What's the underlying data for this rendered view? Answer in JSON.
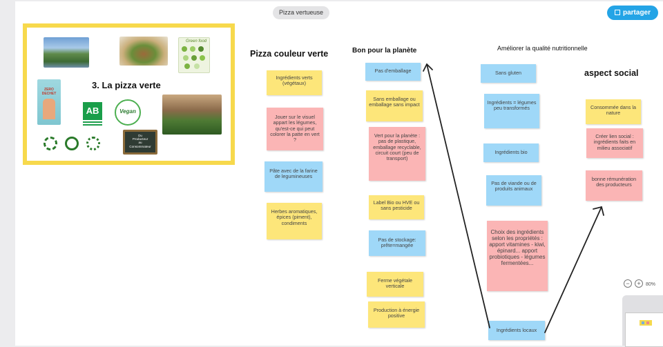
{
  "header": {
    "board_title": "Pizza vertueuse",
    "share_label": "partager",
    "share_icon": "qr-icon"
  },
  "slide": {
    "title": "3. La pizza verte",
    "images": [
      "waterfall-photo",
      "burger-photo",
      "green-food-poster",
      "zero-dechet-book",
      "ab-bio-logo",
      "vegan-logo",
      "garden-people-photo",
      "recycle-logos",
      "producteur-consommateur-chalkboard"
    ],
    "green_food_label": "Green food",
    "book_title": "ZERO DECHET",
    "ab_label": "AB",
    "vegan_label": "Vegan",
    "chalk_lines": [
      "Du",
      "Producteur",
      "au",
      "Consommateur"
    ]
  },
  "columns": {
    "pizza_couleur_verte": "Pizza couleur verte",
    "bon_pour_la_planete": "Bon pour la planète",
    "ameliorer_qualite": "Améliorer la qualité nutritionnelle",
    "aspect_social": "aspect social"
  },
  "notes": {
    "col1": [
      {
        "text": "Ingrédients verts (végétaux)",
        "color": "#fde67a"
      },
      {
        "text": "Jouer sur le visuel appart les légumes, qu'est-ce qui peut colorer la patte en vert ?",
        "color": "#fbb5b5"
      },
      {
        "text": "Pâte avec de la farine de legumineuses",
        "color": "#9fd8f8"
      },
      {
        "text": "Herbes aromatiques, épices (piment), condiments",
        "color": "#fde67a"
      }
    ],
    "col2": [
      {
        "text": "Pas d'emballage",
        "color": "#9fd8f8"
      },
      {
        "text": "Sans emballage ou emballage sans impact",
        "color": "#fde67a"
      },
      {
        "text": "Vert pour la planète : pas de plastique, emballage recyclable, circuit court (peu de transport)",
        "color": "#fbb5b5"
      },
      {
        "text": "Label Bio ou HVE ou sans pesticide",
        "color": "#fde67a"
      },
      {
        "text": "Pas de stockage: prête=mangée",
        "color": "#9fd8f8"
      },
      {
        "text": "Ferme végétale verticale",
        "color": "#fde67a"
      },
      {
        "text": "Production à énergie positive",
        "color": "#fde67a"
      }
    ],
    "col3": [
      {
        "text": "Sans gluten",
        "color": "#9fd8f8"
      },
      {
        "text": "Ingrédients = légumes peu transformés",
        "color": "#9fd8f8"
      },
      {
        "text": "Ingrédients bio",
        "color": "#9fd8f8"
      },
      {
        "text": "Pas de viande ou de produits animaux",
        "color": "#9fd8f8"
      },
      {
        "text": "Choix des ingrédients selon les propriétés : apport vitamines - kiwi, épinard... apport probiotiques - légumes fermentées...",
        "color": "#fbb5b5"
      },
      {
        "text": "Ingrédients locaux",
        "color": "#9fd8f8"
      }
    ],
    "col4": [
      {
        "text": "Consommée dans la nature",
        "color": "#fde67a"
      },
      {
        "text": "Créer lien social : ingrédients faits en milieu associatif",
        "color": "#fbb5b5"
      },
      {
        "text": "bonne rémunération des producteurs",
        "color": "#fbb5b5"
      }
    ]
  },
  "zoom": {
    "level": "80%",
    "minus_icon": "zoom-out-icon",
    "plus_icon": "zoom-in-icon"
  }
}
